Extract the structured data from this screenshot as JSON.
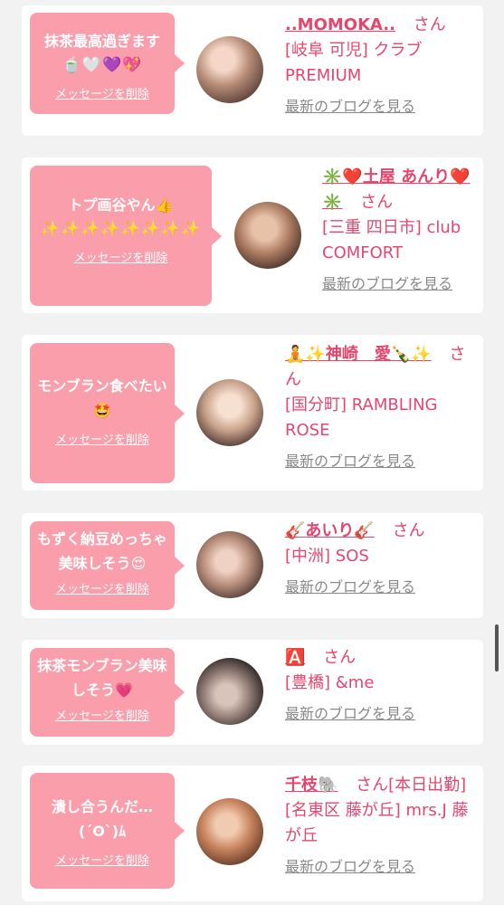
{
  "colors": {
    "background": "#f2f2f2",
    "card": "#ffffff",
    "bubble": "#fb9eac",
    "accent": "#e6466e",
    "link_gray": "#888888"
  },
  "delete_label": "メッセージを削除",
  "blog_label": "最新のブログを見る",
  "honorific": "さん",
  "items": [
    {
      "message": "抹茶最高過ぎます",
      "emoji": "🍵🤍💜💖",
      "name": "..MOMOKA..",
      "shop": "[岐阜 可児] クラブ PREMIUM",
      "status": ""
    },
    {
      "message": "トプ画谷やん👍",
      "emoji": "✨✨✨✨✨✨✨✨",
      "name": "✳️❤️土屋 あんり❤️✳️",
      "shop": "[三重 四日市] club COMFORT",
      "status": ""
    },
    {
      "message": "モンブラン食べたい🤩",
      "emoji": "",
      "name": "🧘✨神崎　愛🍾✨",
      "shop": "[国分町] RAMBLING ROSE",
      "status": ""
    },
    {
      "message": "もずく納豆めっちゃ美味しそう😍",
      "emoji": "",
      "name": "🎸あいり🎸",
      "shop": "[中洲] SOS",
      "status": ""
    },
    {
      "message": "抹茶モンブラン美味しそう💗",
      "emoji": "",
      "name": "🅰️",
      "shop": "[豊橋] &me",
      "status": ""
    },
    {
      "message": "潰し合うんだ…(´ʘ`)ﾑ",
      "emoji": "",
      "name": "千枝🐘",
      "shop": "[名東区 藤が丘] mrs.J 藤が丘",
      "status": "[本日出勤]"
    }
  ]
}
